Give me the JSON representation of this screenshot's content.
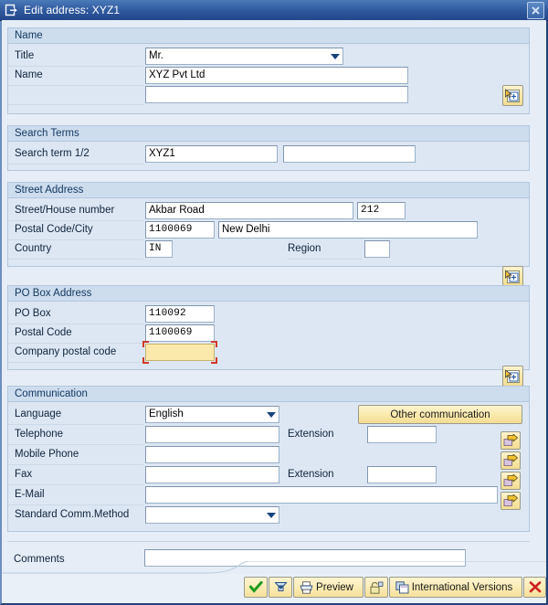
{
  "window": {
    "title": "Edit address:  XYZ1",
    "icon": "edit-document-icon",
    "close_label": "x"
  },
  "groups": {
    "name": {
      "title": "Name",
      "fields": {
        "title_label": "Title",
        "title_value": "Mr.",
        "name_label": "Name",
        "name_value": "XYZ Pvt Ltd",
        "name2_value": ""
      },
      "detail_button": "details-icon"
    },
    "search_terms": {
      "title": "Search Terms",
      "fields": {
        "search_label": "Search term 1/2",
        "search1_value": "XYZ1",
        "search2_value": ""
      }
    },
    "street_address": {
      "title": "Street Address",
      "fields": {
        "street_label": "Street/House number",
        "street_value": "Akbar Road",
        "house_value": "212",
        "postal_city_label": "Postal Code/City",
        "postal_value": "1100069",
        "city_value": "New Delhi",
        "country_label": "Country",
        "country_value": "IN",
        "region_label": "Region",
        "region_value": ""
      },
      "detail_button": "details-icon"
    },
    "po_box": {
      "title": "PO Box Address",
      "fields": {
        "pobox_label": "PO Box",
        "pobox_value": "110092",
        "postal_label": "Postal Code",
        "postal_value": "1100069",
        "company_postal_label": "Company postal code",
        "company_postal_value": ""
      },
      "detail_button": "details-icon"
    },
    "communication": {
      "title": "Communication",
      "fields": {
        "language_label": "Language",
        "language_value": "English",
        "telephone_label": "Telephone",
        "telephone_value": "",
        "extension1_label": "Extension",
        "extension1_value": "",
        "mobile_label": "Mobile Phone",
        "mobile_value": "",
        "fax_label": "Fax",
        "fax_value": "",
        "extension2_label": "Extension",
        "extension2_value": "",
        "email_label": "E-Mail",
        "email_value": "",
        "std_comm_label": "Standard Comm.Method",
        "std_comm_value": ""
      },
      "other_communication_button": "Other communication",
      "arrow_buttons": [
        "telephone-detail-arrow",
        "mobile-detail-arrow",
        "fax-detail-arrow",
        "email-detail-arrow"
      ]
    }
  },
  "comments": {
    "label": "Comments",
    "value": ""
  },
  "footer": {
    "buttons": [
      {
        "name": "continue-button",
        "icon": "green-check-icon",
        "label": ""
      },
      {
        "name": "filter-button",
        "icon": "funnel-down-icon",
        "label": ""
      },
      {
        "name": "preview-button",
        "icon": "printer-icon",
        "label": "Preview"
      },
      {
        "name": "lock-button",
        "icon": "padlock-icon",
        "label": ""
      },
      {
        "name": "international-versions-button",
        "icon": "copy-window-icon",
        "label": "International Versions"
      },
      {
        "name": "cancel-button",
        "icon": "red-x-icon",
        "label": ""
      }
    ]
  },
  "colors": {
    "titlebar": "#2d569a",
    "group_header": "#cdddee",
    "panel": "#dde7f3",
    "focus_field": "#fbe9ac",
    "focus_marker": "#d03a2a",
    "button": "#fae9ac"
  }
}
